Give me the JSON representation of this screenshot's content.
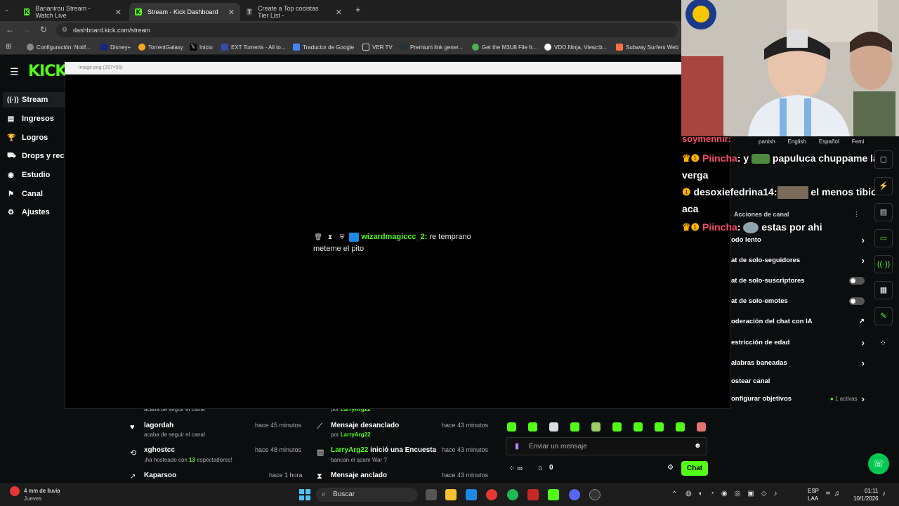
{
  "browser": {
    "tabs": [
      {
        "label": "Bananirou Stream - Watch Live"
      },
      {
        "label": "Stream - Kick Dashboard"
      },
      {
        "label": "Create a Top cocistas Tier List -"
      }
    ],
    "new_tab": "+",
    "url": "dashboard.kick.com/stream",
    "bookmarks": [
      "Configuración: Notif...",
      "Disney+",
      "TorrentGalaxy",
      "Inicio",
      "EXT Torrents - All to...",
      "Traductor de Google",
      "VER TV",
      "Premium link gener...",
      "Get the M3U8 File fr...",
      "VDO.Ninja, View=b...",
      "Subway Surfers Web"
    ]
  },
  "app": {
    "logo": "KICK",
    "nav": [
      {
        "label": "Stream",
        "icon": "stream-icon"
      },
      {
        "label": "Ingresos",
        "icon": "income-icon"
      },
      {
        "label": "Logros",
        "icon": "trophy-icon"
      },
      {
        "label": "Drops y rec",
        "icon": "drops-icon"
      },
      {
        "label": "Estudio",
        "icon": "studio-icon"
      },
      {
        "label": "Canal",
        "icon": "channel-icon"
      },
      {
        "label": "Ajustes",
        "icon": "settings-icon"
      }
    ]
  },
  "viewer": {
    "title": "image.png (297×55)",
    "message": {
      "username": "wizardmagiccc_2:",
      "text": " re temprano",
      "text2": "meteme el pito"
    }
  },
  "activity": [
    {
      "title": "",
      "sub": "acaba de seguir el canal",
      "time": ""
    },
    {
      "title": "lagordah",
      "sub": "acaba de seguir el canal",
      "time": "hace 45 minutos"
    },
    {
      "title": "xghostcc",
      "sub_a": "¡ha hosteado con ",
      "sub_num": "13",
      "sub_b": " espectadores!",
      "time": "hace 48 minutos"
    },
    {
      "title": "Kaparsoo",
      "time": "hace 1 hora"
    }
  ],
  "modlog": [
    {
      "sub_a": "por ",
      "user": "LarryArg22"
    },
    {
      "title": "Mensaje desanclado",
      "sub_a": "por ",
      "user": "LarryArg22",
      "time": "hace 43 minutos"
    },
    {
      "user": "LarryArg22",
      "title": " inició una Encuesta",
      "sub": "bancan el spam War ?",
      "time": "hace 43 minutos"
    },
    {
      "title": "Mensaje anclado",
      "time": "hace 43 minutos"
    }
  ],
  "chat": {
    "placeholder": "Enviar un mensaje",
    "count": "0",
    "send_label": "Chat"
  },
  "overlay_chat": {
    "partial_user": "soymennir:",
    "languages": [
      "panish",
      "English",
      "Español",
      "Femi"
    ],
    "lines": [
      {
        "user": "Piincha",
        "text": ": y ",
        "text2": " papuluca chuppame la verga"
      },
      {
        "user": "desoxiefedrina14:",
        "text": " el menos tibio de aca"
      },
      {
        "user": "Piincha",
        "text": ": ",
        "text2": " estas por ahi"
      }
    ]
  },
  "settings": {
    "header": "Acciones de canal",
    "items": [
      {
        "label": "odo lento",
        "control": "chevron"
      },
      {
        "label": "at de solo-seguidores",
        "control": "chevron"
      },
      {
        "label": "at de solo-suscriptores",
        "control": "toggle"
      },
      {
        "label": "at de solo-emotes",
        "control": "toggle"
      },
      {
        "label": "oderación del chat con IA",
        "control": "external"
      },
      {
        "label": "estricción de edad",
        "control": "chevron"
      },
      {
        "label": "alabras baneadas",
        "control": "chevron"
      },
      {
        "label": "ostear canal",
        "control": "none"
      },
      {
        "label": "onfigurar objetivos",
        "control": "chevron",
        "badge": "1 activas"
      }
    ]
  },
  "taskbar": {
    "weather": "4 mm de lluvia",
    "weather_day": "Jueves",
    "search": "Buscar",
    "lang": "ESP",
    "lang2": "LAA",
    "time": "01:11",
    "date": "10/1/2026"
  },
  "colors": {
    "kick_green": "#53fc18",
    "background": "#0b0e0f",
    "pink_user": "#ff4d6d"
  }
}
